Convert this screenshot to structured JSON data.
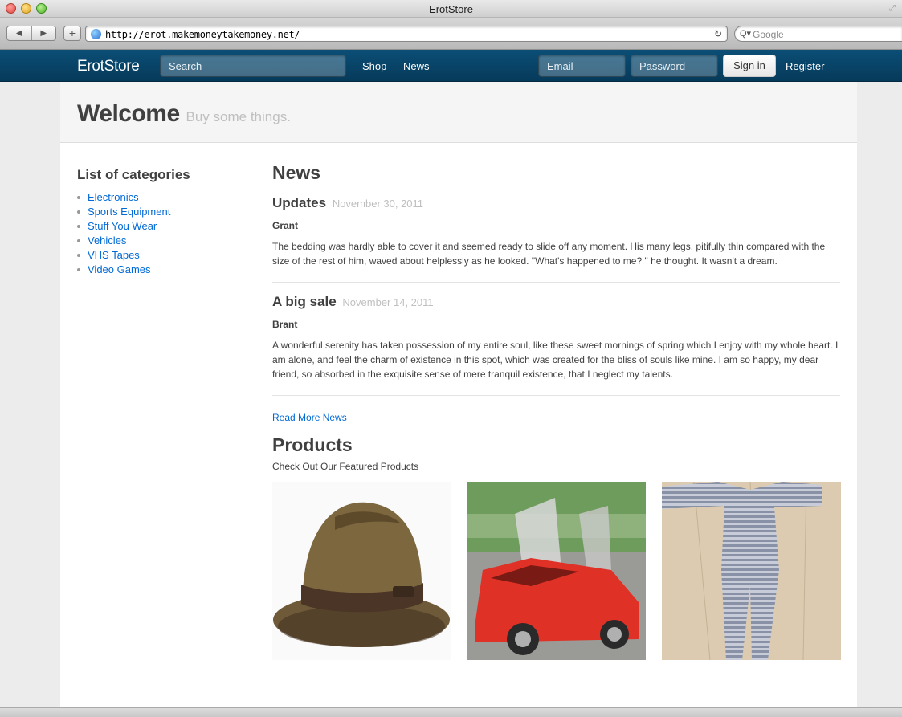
{
  "window": {
    "title": "ErotStore"
  },
  "browser": {
    "url": "http://erot.makemoneytakemoney.net/",
    "search_placeholder": "Google",
    "back": "◀",
    "forward": "▶",
    "add_tab": "+",
    "reload": "↻",
    "search_icon": "Q▾"
  },
  "navbar": {
    "brand": "ErotStore",
    "search_placeholder": "Search",
    "links": {
      "shop": "Shop",
      "news": "News",
      "register": "Register"
    },
    "email_placeholder": "Email",
    "password_placeholder": "Password",
    "signin": "Sign in"
  },
  "hero": {
    "title": "Welcome",
    "subtitle": "Buy some things."
  },
  "sidebar": {
    "title": "List of categories",
    "categories": [
      "Electronics",
      "Sports Equipment",
      "Stuff You Wear",
      "Vehicles",
      "VHS Tapes",
      "Video Games"
    ]
  },
  "news": {
    "heading": "News",
    "posts": [
      {
        "title": "Updates",
        "date": "November 30, 2011",
        "author": "Grant",
        "body": "The bedding was hardly able to cover it and seemed ready to slide off any moment. His many legs, pitifully thin compared with the size of the rest of him, waved about helplessly as he looked. \"What's happened to me? \" he thought. It wasn't a dream."
      },
      {
        "title": "A big sale",
        "date": "November 14, 2011",
        "author": "Brant",
        "body": "A wonderful serenity has taken possession of my entire soul, like these sweet mornings of spring which I enjoy with my whole heart. I am alone, and feel the charm of existence in this spot, which was created for the bliss of souls like mine. I am so happy, my dear friend, so absorbed in the exquisite sense of mere tranquil existence, that I neglect my talents."
      }
    ],
    "read_more": "Read More News"
  },
  "products": {
    "heading": "Products",
    "subtitle": "Check Out Our Featured Products"
  },
  "colors": {
    "navbar": "#0b4e76",
    "link": "#0069d6",
    "text": "#404040",
    "muted": "#bfbfbf"
  }
}
